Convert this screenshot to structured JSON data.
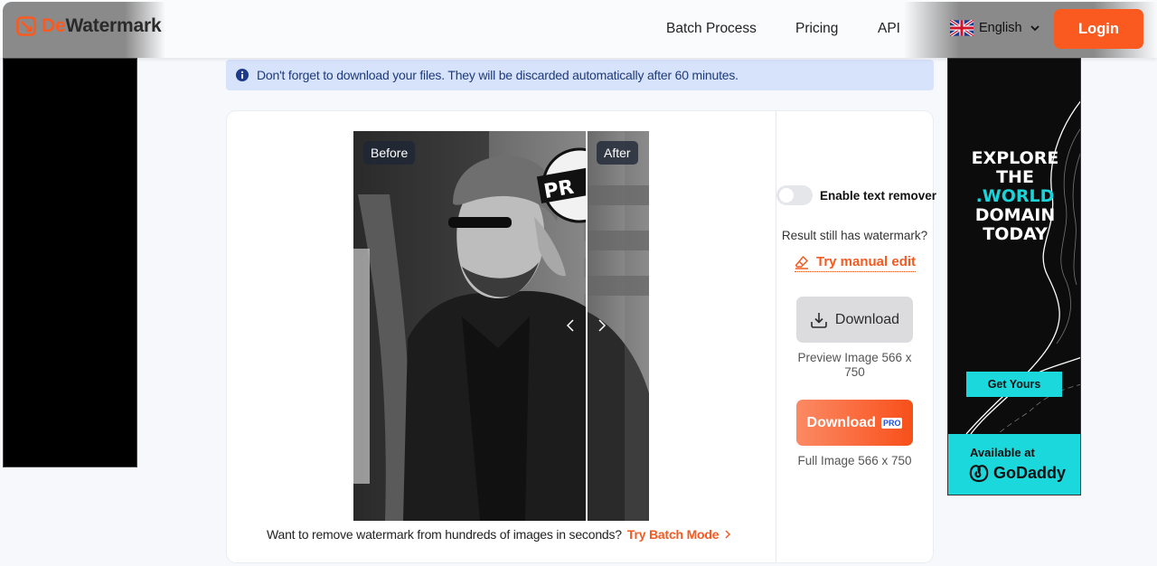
{
  "header": {
    "brand_prefix": "De",
    "brand_suffix": "Watermark",
    "nav": [
      {
        "label": "Batch Process"
      },
      {
        "label": "Pricing"
      },
      {
        "label": "API"
      }
    ],
    "language": "English",
    "login_label": "Login"
  },
  "notice": {
    "icon": "info-icon",
    "text": "Don't forget to download your files. They will be discarded automatically after 60 minutes."
  },
  "compare": {
    "before_label": "Before",
    "after_label": "After"
  },
  "batch": {
    "prompt": "Want to remove watermark from hundreds of images in seconds?",
    "link_label": "Try Batch Mode"
  },
  "panel": {
    "toggle_label": "Enable text remover",
    "toggle_on": false,
    "still_watermark": "Result still has watermark?",
    "manual_edit_label": "Try manual edit",
    "download_preview_label": "Download",
    "preview_info": "Preview Image 566 x 750",
    "download_full_label": "Download",
    "pro_badge": "PRO",
    "full_info": "Full Image 566 x 750"
  },
  "ad": {
    "line1": "EXPLORE",
    "line2": "THE",
    "line3": ".WORLD",
    "line4": "DOMAIN",
    "line5": "TODAY",
    "cta": "Get Yours",
    "available": "Available at",
    "brand": "GoDaddy"
  },
  "colors": {
    "accent": "#fa5a1f",
    "notice_bg": "#d7e3fb",
    "ad_teal": "#1bd8dc"
  }
}
